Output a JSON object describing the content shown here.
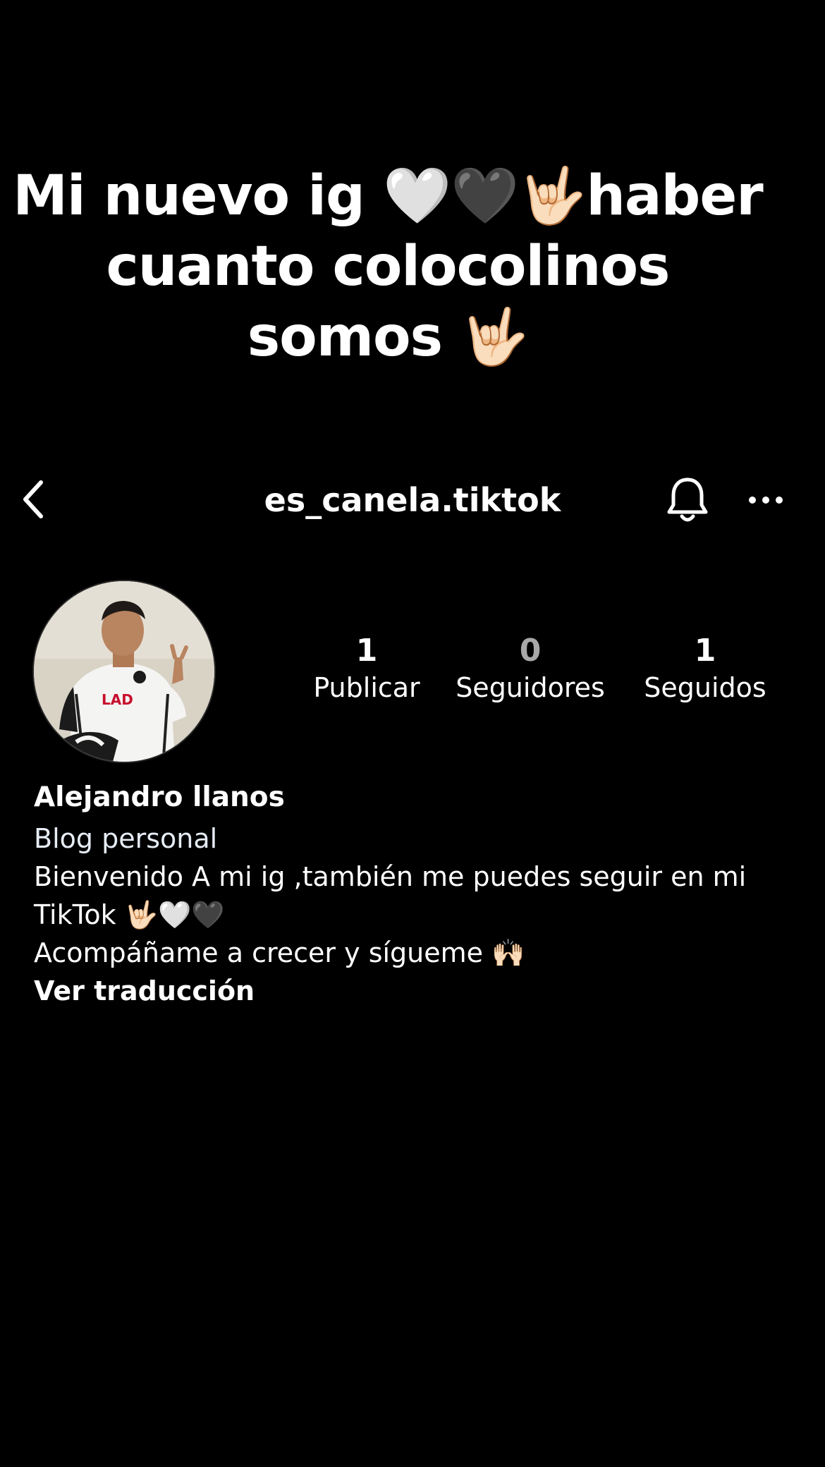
{
  "overlay": {
    "caption_line1": "Mi nuevo ig  🤍🖤🤟🏻haber",
    "caption_line2": "cuanto colocolinos",
    "caption_line3": "somos 🤟🏻"
  },
  "header": {
    "username": "es_canela.tiktok",
    "icons": {
      "back": "chevron-left-icon",
      "notifications": "bell-icon",
      "more": "more-horizontal-icon"
    }
  },
  "profile": {
    "avatar": "profile-photo",
    "stats": [
      {
        "value": "1",
        "label": "Publicar"
      },
      {
        "value": "0",
        "label": "Seguidores"
      },
      {
        "value": "1",
        "label": "Seguidos"
      }
    ],
    "name": "Alejandro llanos",
    "category": "Blog personal",
    "bio_line1": "Bienvenido A mi ig ,también me puedes seguir en mi",
    "bio_line2": "TikTok 🤟🏻🤍🖤",
    "bio_line3": "Acompáñame a crecer y sígueme 🙌🏻",
    "translate_label": "Ver traducción"
  },
  "colors": {
    "background": "#000000",
    "text": "#ffffff",
    "muted": "#a8a8a8",
    "category": "#e6ecf5"
  }
}
